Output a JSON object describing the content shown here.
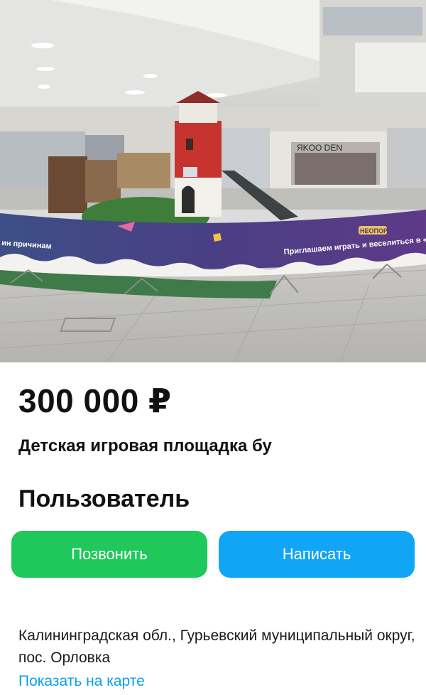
{
  "listing": {
    "price": "300 000 ₽",
    "title": "Детская игровая площадка бу",
    "seller_name": "Пользователь",
    "address": "Калининградская обл., Гурьевский муниципальный округ, пос. Орловка",
    "map_link_label": "Показать на карте"
  },
  "actions": {
    "call_label": "Позвонить",
    "message_label": "Написать"
  },
  "photo": {
    "banner_text": "Приглашаем играть и веселиться в «Неопорт»",
    "banner_text_left": "ин причинам",
    "banner_logo": "НЕОПОРТ",
    "store_sign": "ЯKOO DEN"
  },
  "colors": {
    "call_button": "#1ec85b",
    "message_button": "#10a5f5",
    "link": "#0aa0ee",
    "banner": "#5b3a86",
    "lighthouse_red": "#c7332f"
  }
}
